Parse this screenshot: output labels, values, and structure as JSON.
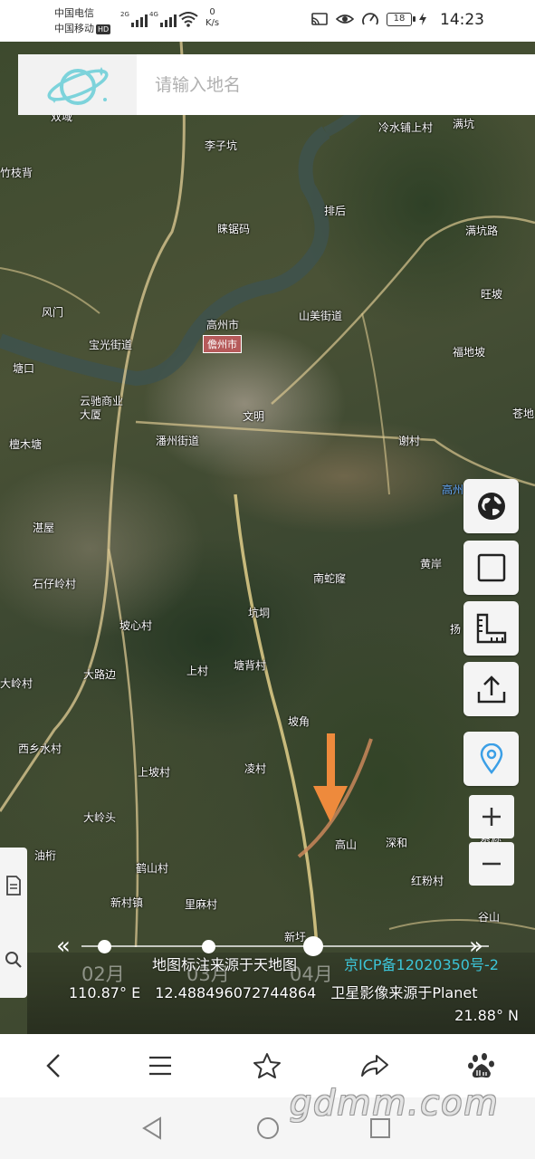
{
  "status_bar": {
    "carrier1": "中国电信",
    "carrier2": "中国移动",
    "hd": "HD",
    "net1": "2G",
    "net2": "4G",
    "net_speed_value": "0",
    "net_speed_unit": "K/s",
    "battery": "18",
    "time": "14:23"
  },
  "search": {
    "placeholder": "请输入地名"
  },
  "map": {
    "city_badge": "儋州市",
    "places": [
      {
        "name": "双域"
      },
      {
        "name": "李子坑"
      },
      {
        "name": "冷水铺上村"
      },
      {
        "name": "满坑"
      },
      {
        "name": "竹枝背"
      },
      {
        "name": "排后"
      },
      {
        "name": "睐锯码"
      },
      {
        "name": "满坑路"
      },
      {
        "name": "高州市"
      },
      {
        "name": "山美街道"
      },
      {
        "name": "旺坡"
      },
      {
        "name": "风门"
      },
      {
        "name": "宝光街道"
      },
      {
        "name": "福地坡"
      },
      {
        "name": "塘口"
      },
      {
        "name": "云驰商业大厦"
      },
      {
        "name": "文明"
      },
      {
        "name": "苍地"
      },
      {
        "name": "檀木塘"
      },
      {
        "name": "潘州街道"
      },
      {
        "name": "谢村"
      },
      {
        "name": "高州东站"
      },
      {
        "name": "湛屋"
      },
      {
        "name": "南蛇窿"
      },
      {
        "name": "石仔岭村"
      },
      {
        "name": "黄岸"
      },
      {
        "name": "坑垌"
      },
      {
        "name": "坡心村"
      },
      {
        "name": "扬"
      },
      {
        "name": "大路边"
      },
      {
        "name": "上村"
      },
      {
        "name": "塘背村"
      },
      {
        "name": "大岭村"
      },
      {
        "name": "坡角"
      },
      {
        "name": "西乡水村"
      },
      {
        "name": "凌村"
      },
      {
        "name": "上坡村"
      },
      {
        "name": "大岭头"
      },
      {
        "name": "高山"
      },
      {
        "name": "深和"
      },
      {
        "name": "紫源"
      },
      {
        "name": "油桁"
      },
      {
        "name": "鹤山村"
      },
      {
        "name": "红粉村"
      },
      {
        "name": "新村镇"
      },
      {
        "name": "里麻村"
      },
      {
        "name": "谷山"
      },
      {
        "name": "新圩"
      }
    ]
  },
  "timeline": {
    "months": [
      "02月",
      "03月",
      "04月"
    ]
  },
  "footer_info": {
    "attribution": "地图标注来源于天地图",
    "icp": "京ICP备12020350号-2",
    "lon": "110.87° E",
    "value": "12.488496072744864",
    "imagery_source": "卫星影像来源于Planet",
    "lat": "21.88° N"
  },
  "watermark": "gdmm.com"
}
